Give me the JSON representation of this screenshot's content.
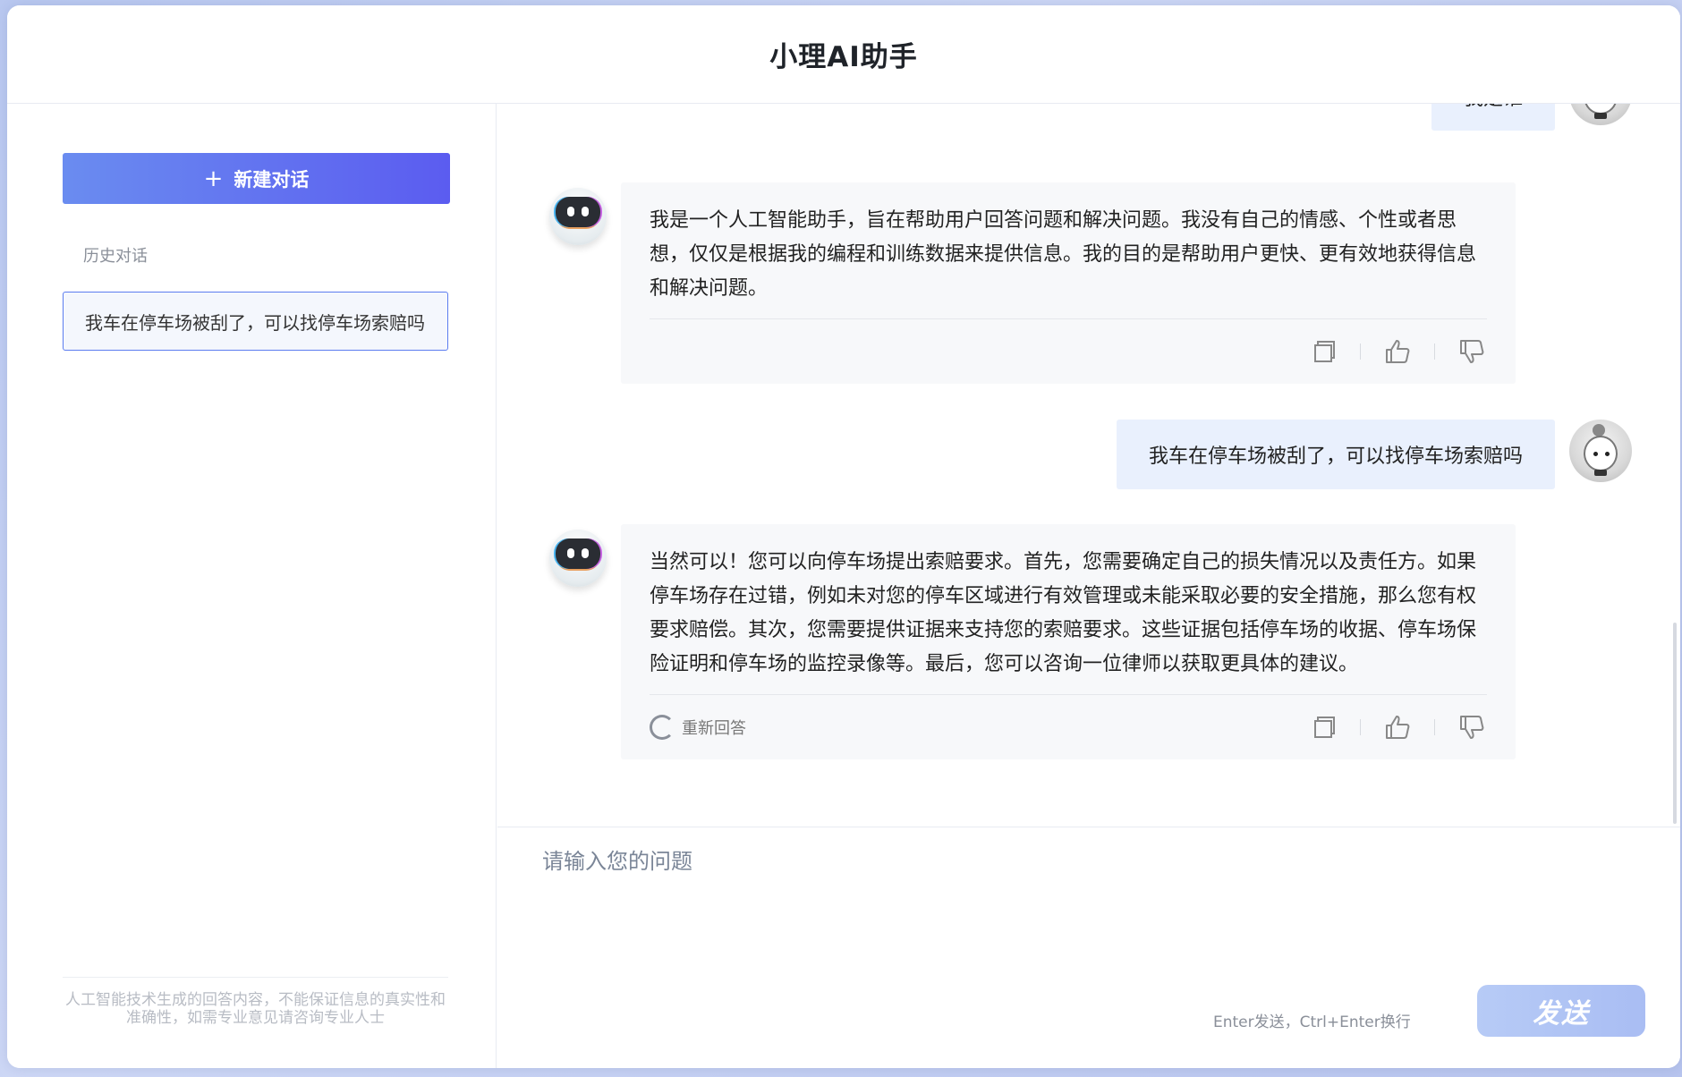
{
  "app": {
    "title": "小理AI助手"
  },
  "sidebar": {
    "new_chat_label": "新建对话",
    "history_title": "历史对话",
    "history_items": [
      {
        "label": "我车在停车场被刮了，可以找停车场索赔吗"
      }
    ],
    "disclaimer": "人工智能技术生成的回答内容，不能保证信息的真实性和准确性，如需专业意见请咨询专业人士"
  },
  "chat": {
    "messages": [
      {
        "role": "user",
        "text": "我是谁"
      },
      {
        "role": "bot",
        "text": "我是一个人工智能助手，旨在帮助用户回答问题和解决问题。我没有自己的情感、个性或者思想，仅仅是根据我的编程和训练数据来提供信息。我的目的是帮助用户更快、更有效地获得信息和解决问题。"
      },
      {
        "role": "user",
        "text": "我车在停车场被刮了，可以找停车场索赔吗"
      },
      {
        "role": "bot",
        "text": "当然可以！您可以向停车场提出索赔要求。首先，您需要确定自己的损失情况以及责任方。如果停车场存在过错，例如未对您的停车区域进行有效管理或未能采取必要的安全措施，那么您有权要求赔偿。其次，您需要提供证据来支持您的索赔要求。这些证据包括停车场的收据、停车场保险证明和停车场的监控录像等。最后，您可以咨询一位律师以获取更具体的建议。",
        "regen_label": "重新回答"
      }
    ],
    "icons": {
      "copy": "copy-icon",
      "like": "thumbs-up-icon",
      "dislike": "thumbs-down-icon",
      "regen": "refresh-icon"
    }
  },
  "input": {
    "placeholder": "请输入您的问题",
    "value": "",
    "hint": "Enter发送，Ctrl+Enter换行",
    "send_label": "发送"
  },
  "colors": {
    "accent": "#5b5cf0",
    "user_bubble": "#e9f0fd",
    "bot_bubble": "#f7f8fa"
  }
}
